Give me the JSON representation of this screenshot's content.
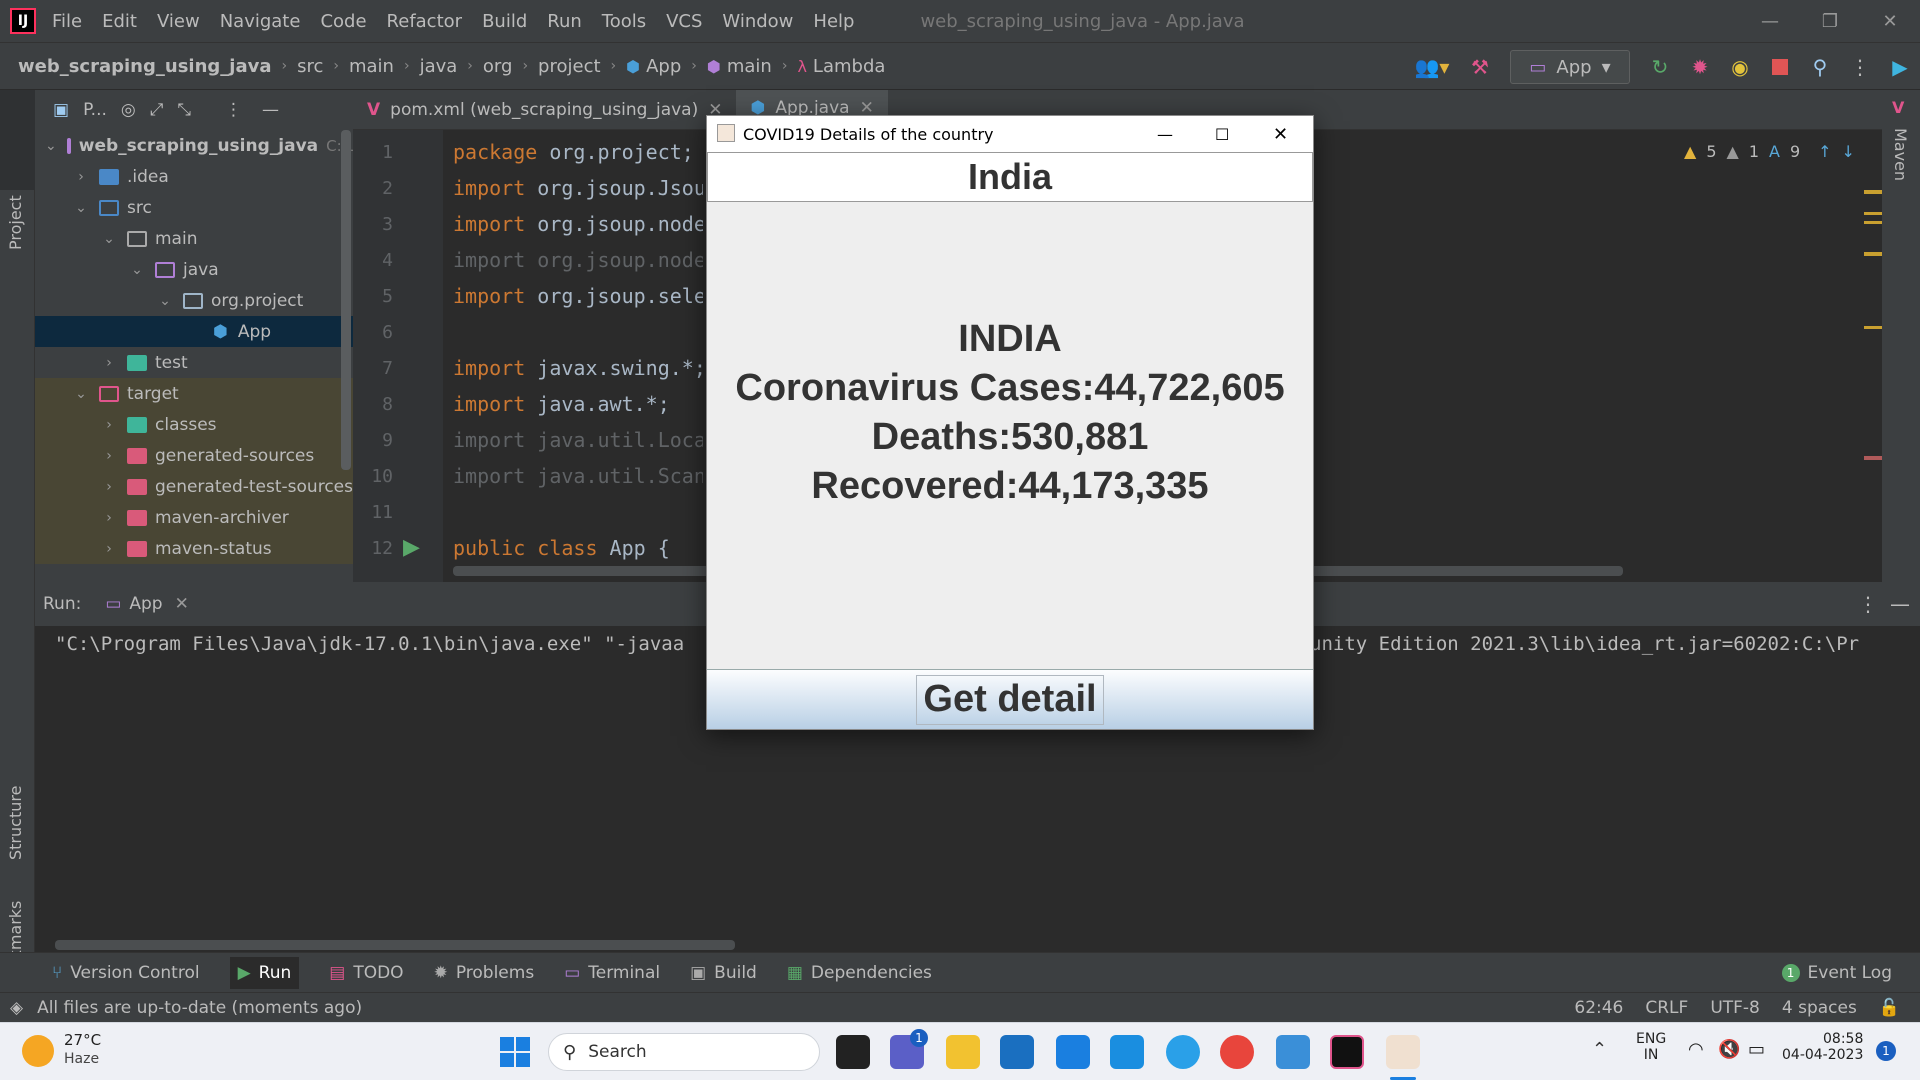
{
  "menu": {
    "items": [
      "File",
      "Edit",
      "View",
      "Navigate",
      "Code",
      "Refactor",
      "Build",
      "Run",
      "Tools",
      "VCS",
      "Window",
      "Help"
    ],
    "window_title": "web_scraping_using_java - App.java"
  },
  "breadcrumbs": [
    "web_scraping_using_java",
    "src",
    "main",
    "java",
    "org",
    "project",
    "App",
    "main",
    "Lambda"
  ],
  "toolbar": {
    "run_config": "App"
  },
  "left_strip": {
    "project_tab": "Project",
    "structure_tab": "Structure",
    "bookmarks_tab": "Bookmarks"
  },
  "right_strip": {
    "maven_tab": "Maven"
  },
  "project_panel": {
    "header": "P...",
    "tree": [
      {
        "label": "web_scraping_using_java",
        "extra": "C:\\Use"
      },
      {
        "label": ".idea"
      },
      {
        "label": "src"
      },
      {
        "label": "main"
      },
      {
        "label": "java"
      },
      {
        "label": "org.project"
      },
      {
        "label": "App"
      },
      {
        "label": "test"
      },
      {
        "label": "target"
      },
      {
        "label": "classes"
      },
      {
        "label": "generated-sources"
      },
      {
        "label": "generated-test-sources"
      },
      {
        "label": "maven-archiver"
      },
      {
        "label": "maven-status"
      }
    ]
  },
  "editor": {
    "tabs": [
      {
        "label": "pom.xml (web_scraping_using_java)"
      },
      {
        "label": "App.java"
      }
    ],
    "inspections": {
      "warnings": "5",
      "weak_warnings": "1",
      "typos": "9"
    },
    "line_numbers": [
      "1",
      "2",
      "3",
      "4",
      "5",
      "6",
      "7",
      "8",
      "9",
      "10",
      "11",
      "12"
    ],
    "lines": [
      {
        "kw": "package",
        "rest": " org.project;"
      },
      {
        "kw": "import",
        "rest": " org.jsoup.Jsou"
      },
      {
        "kw": "import",
        "rest": " org.jsoup.node"
      },
      {
        "kw": "import",
        "rest": " org.jsoup.node"
      },
      {
        "kw": "import",
        "rest": " org.jsoup.sele"
      },
      {
        "kw": "",
        "rest": ""
      },
      {
        "kw": "import",
        "rest": " javax.swing.*;"
      },
      {
        "kw": "import",
        "rest": " java.awt.*;"
      },
      {
        "kw": "import",
        "rest": " java.util.Loca"
      },
      {
        "kw": "import",
        "rest": " java.util.Scan"
      },
      {
        "kw": "",
        "rest": ""
      },
      {
        "kw": "public class",
        "rest": " App {"
      }
    ]
  },
  "run_panel": {
    "label": "Run:",
    "tab": "App",
    "console_left": "\"C:\\Program Files\\Java\\jdk-17.0.1\\bin\\java.exe\" \"-javaa",
    "console_right": "unity Edition 2021.3\\lib\\idea_rt.jar=60202:C:\\Pr"
  },
  "bottom_tabs": [
    {
      "label": "Version Control",
      "icon": "branch-icon"
    },
    {
      "label": "Run",
      "icon": "play-icon"
    },
    {
      "label": "TODO",
      "icon": "list-icon"
    },
    {
      "label": "Problems",
      "icon": "bug-icon"
    },
    {
      "label": "Terminal",
      "icon": "terminal-icon"
    },
    {
      "label": "Build",
      "icon": "hammer-icon"
    },
    {
      "label": "Dependencies",
      "icon": "dependencies-icon"
    }
  ],
  "event_log": {
    "count": "1",
    "label": "Event Log"
  },
  "status_bar": {
    "message": "All files are up-to-date (moments ago)",
    "position": "62:46",
    "line_sep": "CRLF",
    "encoding": "UTF-8",
    "indent": "4 spaces"
  },
  "dialog": {
    "title": "COVID19 Details of the country",
    "country_input": "India",
    "country_heading": "INDIA",
    "cases": "Coronavirus Cases:44,722,605",
    "deaths": "Deaths:530,881",
    "recovered": "Recovered:44,173,335",
    "button": "Get detail"
  },
  "taskbar": {
    "weather_temp": "27°C",
    "weather_desc": "Haze",
    "search_placeholder": "Search",
    "chat_badge": "1",
    "lang_top": "ENG",
    "lang_bottom": "IN",
    "time": "08:58",
    "date": "04-04-2023",
    "notif_count": "1"
  }
}
